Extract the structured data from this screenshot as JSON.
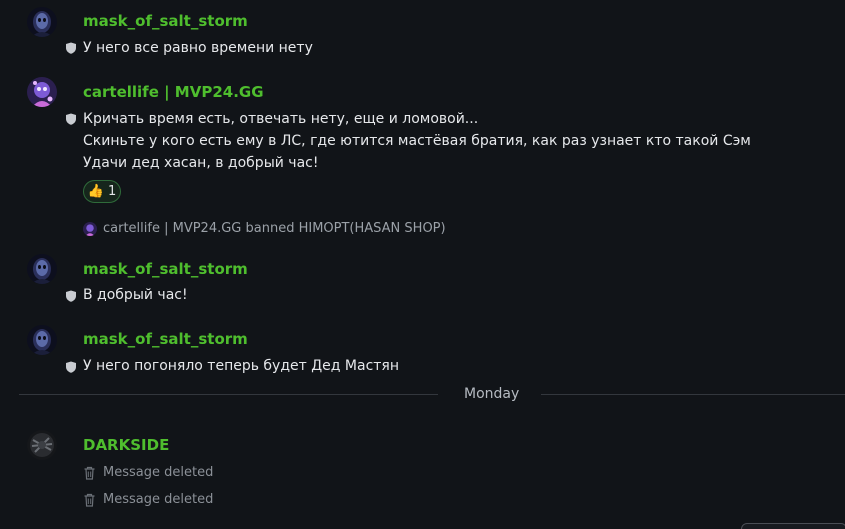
{
  "messages": [
    {
      "username": "mask_of_salt_storm",
      "lines": [
        "У него все равно времени нету"
      ]
    },
    {
      "username": "cartellife | MVP24.GG",
      "lines": [
        "Кричать время есть, отвечать нету, еще и ломовой...",
        "Скиньте у кого есть ему в ЛС, где ютится мастёвая братия, как раз узнает кто такой Сэм",
        "Удачи дед хасан, в добрый час!"
      ],
      "reaction": {
        "emoji": "👍",
        "count": "1"
      },
      "system_event": "cartellife | MVP24.GG banned HIMOPT(HASAN SHOP)"
    },
    {
      "username": "mask_of_salt_storm",
      "lines": [
        "В добрый час!"
      ]
    },
    {
      "username": "mask_of_salt_storm",
      "lines": [
        "У него погоняло теперь будет Дед Мастян"
      ]
    },
    {
      "username": "DARKSIDE",
      "deleted": [
        "Message deleted",
        "Message deleted"
      ]
    }
  ],
  "divider": {
    "label": "Monday"
  },
  "colors": {
    "background": "#111418",
    "username": "#4fbe2e",
    "text": "#e6e8eb",
    "muted": "#8b9097"
  },
  "icons": [
    "shield-icon",
    "thumbs-up-icon",
    "trash-icon"
  ]
}
